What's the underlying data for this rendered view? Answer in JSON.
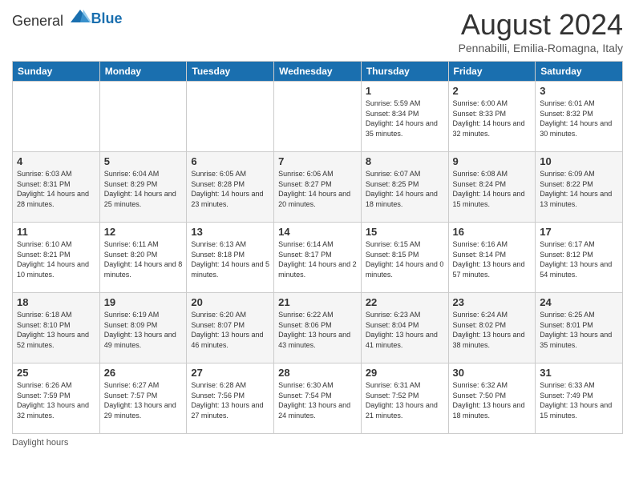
{
  "header": {
    "logo_general": "General",
    "logo_blue": "Blue",
    "title": "August 2024",
    "subtitle": "Pennabilli, Emilia-Romagna, Italy"
  },
  "days_of_week": [
    "Sunday",
    "Monday",
    "Tuesday",
    "Wednesday",
    "Thursday",
    "Friday",
    "Saturday"
  ],
  "weeks": [
    [
      {
        "day": "",
        "info": ""
      },
      {
        "day": "",
        "info": ""
      },
      {
        "day": "",
        "info": ""
      },
      {
        "day": "",
        "info": ""
      },
      {
        "day": "1",
        "info": "Sunrise: 5:59 AM\nSunset: 8:34 PM\nDaylight: 14 hours and 35 minutes."
      },
      {
        "day": "2",
        "info": "Sunrise: 6:00 AM\nSunset: 8:33 PM\nDaylight: 14 hours and 32 minutes."
      },
      {
        "day": "3",
        "info": "Sunrise: 6:01 AM\nSunset: 8:32 PM\nDaylight: 14 hours and 30 minutes."
      }
    ],
    [
      {
        "day": "4",
        "info": "Sunrise: 6:03 AM\nSunset: 8:31 PM\nDaylight: 14 hours and 28 minutes."
      },
      {
        "day": "5",
        "info": "Sunrise: 6:04 AM\nSunset: 8:29 PM\nDaylight: 14 hours and 25 minutes."
      },
      {
        "day": "6",
        "info": "Sunrise: 6:05 AM\nSunset: 8:28 PM\nDaylight: 14 hours and 23 minutes."
      },
      {
        "day": "7",
        "info": "Sunrise: 6:06 AM\nSunset: 8:27 PM\nDaylight: 14 hours and 20 minutes."
      },
      {
        "day": "8",
        "info": "Sunrise: 6:07 AM\nSunset: 8:25 PM\nDaylight: 14 hours and 18 minutes."
      },
      {
        "day": "9",
        "info": "Sunrise: 6:08 AM\nSunset: 8:24 PM\nDaylight: 14 hours and 15 minutes."
      },
      {
        "day": "10",
        "info": "Sunrise: 6:09 AM\nSunset: 8:22 PM\nDaylight: 14 hours and 13 minutes."
      }
    ],
    [
      {
        "day": "11",
        "info": "Sunrise: 6:10 AM\nSunset: 8:21 PM\nDaylight: 14 hours and 10 minutes."
      },
      {
        "day": "12",
        "info": "Sunrise: 6:11 AM\nSunset: 8:20 PM\nDaylight: 14 hours and 8 minutes."
      },
      {
        "day": "13",
        "info": "Sunrise: 6:13 AM\nSunset: 8:18 PM\nDaylight: 14 hours and 5 minutes."
      },
      {
        "day": "14",
        "info": "Sunrise: 6:14 AM\nSunset: 8:17 PM\nDaylight: 14 hours and 2 minutes."
      },
      {
        "day": "15",
        "info": "Sunrise: 6:15 AM\nSunset: 8:15 PM\nDaylight: 14 hours and 0 minutes."
      },
      {
        "day": "16",
        "info": "Sunrise: 6:16 AM\nSunset: 8:14 PM\nDaylight: 13 hours and 57 minutes."
      },
      {
        "day": "17",
        "info": "Sunrise: 6:17 AM\nSunset: 8:12 PM\nDaylight: 13 hours and 54 minutes."
      }
    ],
    [
      {
        "day": "18",
        "info": "Sunrise: 6:18 AM\nSunset: 8:10 PM\nDaylight: 13 hours and 52 minutes."
      },
      {
        "day": "19",
        "info": "Sunrise: 6:19 AM\nSunset: 8:09 PM\nDaylight: 13 hours and 49 minutes."
      },
      {
        "day": "20",
        "info": "Sunrise: 6:20 AM\nSunset: 8:07 PM\nDaylight: 13 hours and 46 minutes."
      },
      {
        "day": "21",
        "info": "Sunrise: 6:22 AM\nSunset: 8:06 PM\nDaylight: 13 hours and 43 minutes."
      },
      {
        "day": "22",
        "info": "Sunrise: 6:23 AM\nSunset: 8:04 PM\nDaylight: 13 hours and 41 minutes."
      },
      {
        "day": "23",
        "info": "Sunrise: 6:24 AM\nSunset: 8:02 PM\nDaylight: 13 hours and 38 minutes."
      },
      {
        "day": "24",
        "info": "Sunrise: 6:25 AM\nSunset: 8:01 PM\nDaylight: 13 hours and 35 minutes."
      }
    ],
    [
      {
        "day": "25",
        "info": "Sunrise: 6:26 AM\nSunset: 7:59 PM\nDaylight: 13 hours and 32 minutes."
      },
      {
        "day": "26",
        "info": "Sunrise: 6:27 AM\nSunset: 7:57 PM\nDaylight: 13 hours and 29 minutes."
      },
      {
        "day": "27",
        "info": "Sunrise: 6:28 AM\nSunset: 7:56 PM\nDaylight: 13 hours and 27 minutes."
      },
      {
        "day": "28",
        "info": "Sunrise: 6:30 AM\nSunset: 7:54 PM\nDaylight: 13 hours and 24 minutes."
      },
      {
        "day": "29",
        "info": "Sunrise: 6:31 AM\nSunset: 7:52 PM\nDaylight: 13 hours and 21 minutes."
      },
      {
        "day": "30",
        "info": "Sunrise: 6:32 AM\nSunset: 7:50 PM\nDaylight: 13 hours and 18 minutes."
      },
      {
        "day": "31",
        "info": "Sunrise: 6:33 AM\nSunset: 7:49 PM\nDaylight: 13 hours and 15 minutes."
      }
    ]
  ],
  "footer": {
    "daylight_hours": "Daylight hours"
  }
}
